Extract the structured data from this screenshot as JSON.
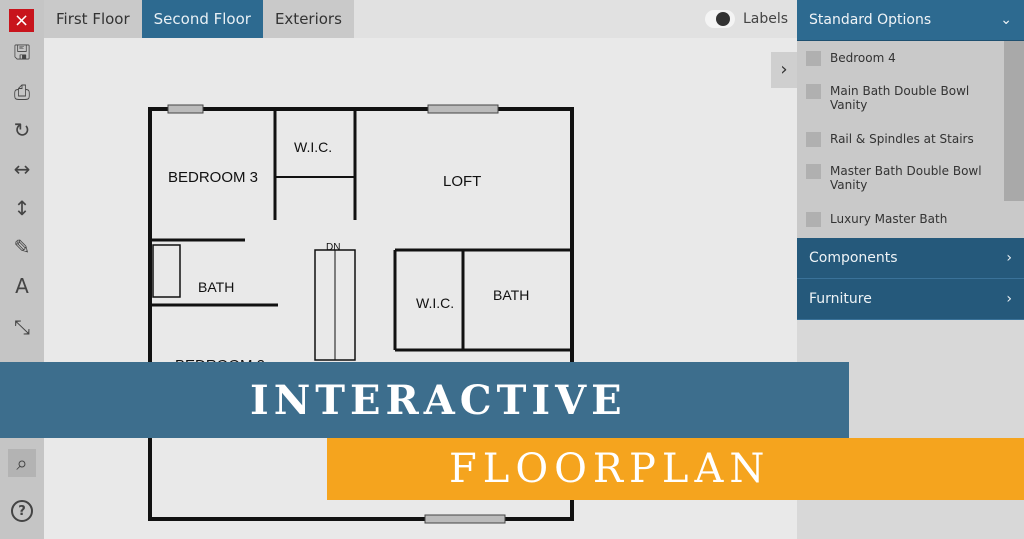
{
  "toolbar": {
    "close_icon": "×",
    "tools": [
      "save-icon",
      "print-icon",
      "rotate-icon",
      "horizontal-resize-icon",
      "vertical-resize-icon",
      "pencil-icon",
      "text-icon",
      "collapse-icon",
      "zoom-icon",
      "help-icon"
    ],
    "glyphs": [
      "🖫",
      "⎙",
      "↻",
      "↔",
      "↕",
      "✎",
      "A",
      "⤡",
      "⌕",
      "?"
    ]
  },
  "tabs": [
    {
      "label": "First Floor"
    },
    {
      "label": "Second Floor",
      "active": true
    },
    {
      "label": "Exteriors"
    }
  ],
  "labels_toggle": {
    "label": "Labels",
    "on": true
  },
  "expand_icon": "›",
  "panel": {
    "standard_options": {
      "title": "Standard Options",
      "chevron": "⌄",
      "items": [
        {
          "label": "Bedroom 4",
          "checked": false
        },
        {
          "label": "Main Bath Double Bowl Vanity",
          "checked": false
        },
        {
          "label": "Rail & Spindles at Stairs",
          "checked": false
        },
        {
          "label": "Master Bath Double Bowl Vanity",
          "checked": false
        },
        {
          "label": "Luxury Master Bath",
          "checked": false
        }
      ]
    },
    "sections": [
      {
        "title": "Components",
        "chevron": "›"
      },
      {
        "title": "Furniture",
        "chevron": "›"
      }
    ]
  },
  "plan": {
    "rooms": {
      "bedroom3": "BEDROOM 3",
      "wic1": "W.I.C.",
      "loft": "LOFT",
      "dn": "DN",
      "bath1": "BATH",
      "wic2": "W.I.C.",
      "bath2": "BATH",
      "bedroom2": "BEDROOM 2"
    }
  },
  "banner": {
    "line1": "INTERACTIVE",
    "line2": "FLOORPLAN"
  },
  "colors": {
    "accent": "#2d6a90",
    "banner_blue": "#3d6e8d",
    "banner_orange": "#f5a41e",
    "close": "#c8141c"
  }
}
